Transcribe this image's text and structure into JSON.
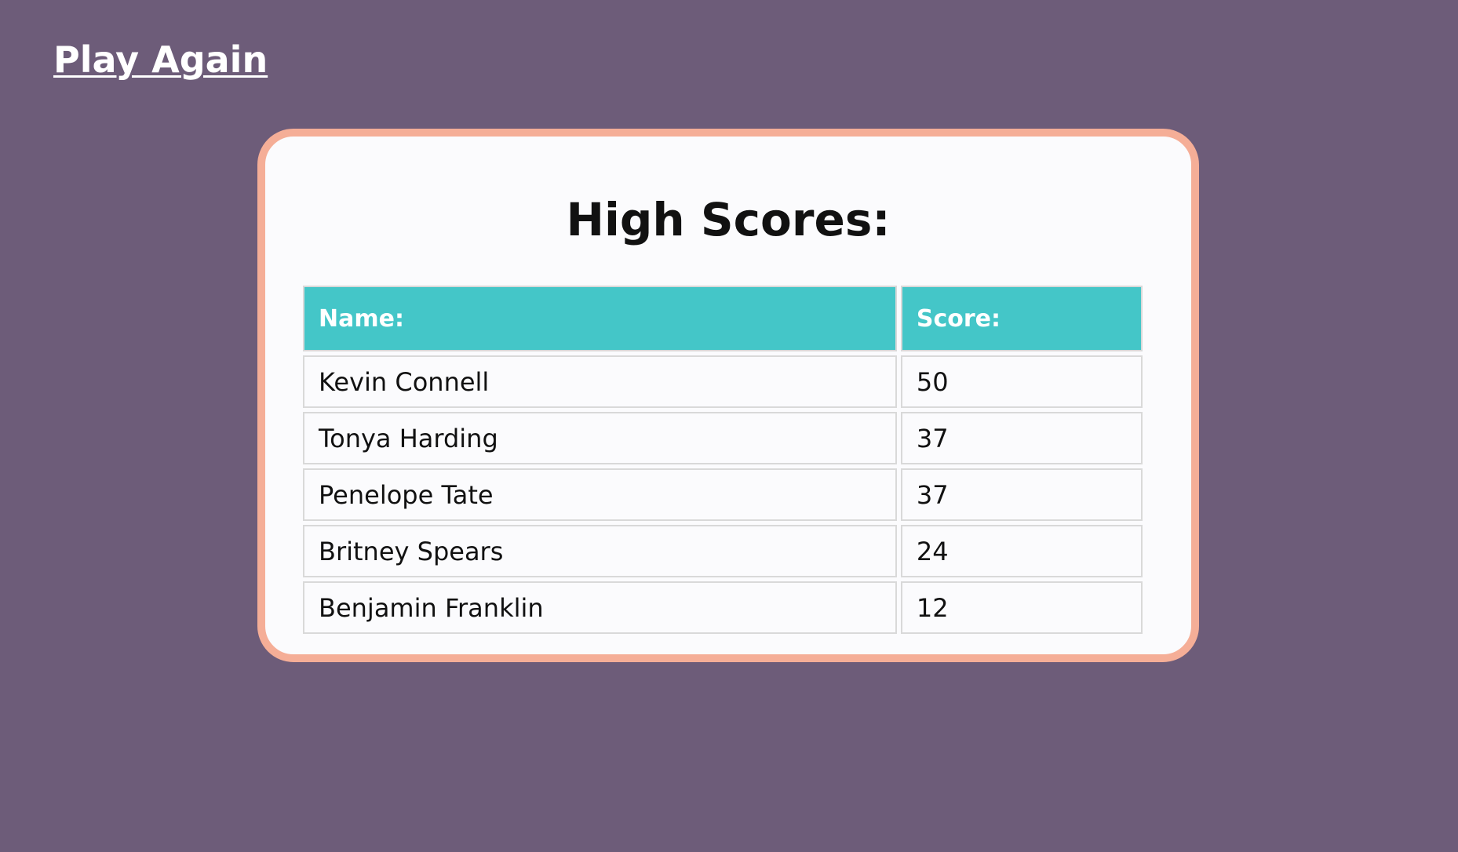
{
  "play_again_label": "Play Again",
  "high_scores": {
    "title": "High Scores:",
    "columns": [
      "Name:",
      "Score:"
    ],
    "rows": [
      {
        "name": "Kevin Connell",
        "score": "50"
      },
      {
        "name": "Tonya Harding",
        "score": "37"
      },
      {
        "name": "Penelope Tate",
        "score": "37"
      },
      {
        "name": "Britney Spears",
        "score": "24"
      },
      {
        "name": "Benjamin Franklin",
        "score": "12"
      }
    ]
  },
  "colors": {
    "background": "#6d5c79",
    "card_border": "#f5ae97",
    "card_background": "#fbfbfd",
    "header_background": "#44c6c8"
  }
}
